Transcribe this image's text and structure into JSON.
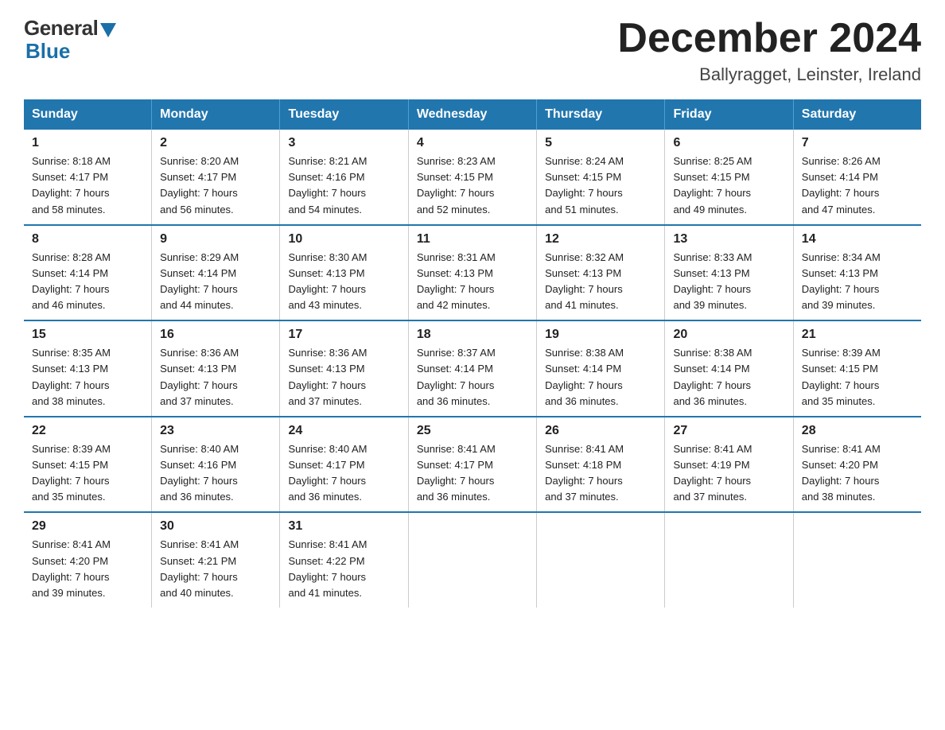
{
  "logo": {
    "general": "General",
    "blue": "Blue",
    "arrow": "▼"
  },
  "title": "December 2024",
  "subtitle": "Ballyragget, Leinster, Ireland",
  "weekdays": [
    "Sunday",
    "Monday",
    "Tuesday",
    "Wednesday",
    "Thursday",
    "Friday",
    "Saturday"
  ],
  "weeks": [
    [
      {
        "day": "1",
        "info": "Sunrise: 8:18 AM\nSunset: 4:17 PM\nDaylight: 7 hours\nand 58 minutes."
      },
      {
        "day": "2",
        "info": "Sunrise: 8:20 AM\nSunset: 4:17 PM\nDaylight: 7 hours\nand 56 minutes."
      },
      {
        "day": "3",
        "info": "Sunrise: 8:21 AM\nSunset: 4:16 PM\nDaylight: 7 hours\nand 54 minutes."
      },
      {
        "day": "4",
        "info": "Sunrise: 8:23 AM\nSunset: 4:15 PM\nDaylight: 7 hours\nand 52 minutes."
      },
      {
        "day": "5",
        "info": "Sunrise: 8:24 AM\nSunset: 4:15 PM\nDaylight: 7 hours\nand 51 minutes."
      },
      {
        "day": "6",
        "info": "Sunrise: 8:25 AM\nSunset: 4:15 PM\nDaylight: 7 hours\nand 49 minutes."
      },
      {
        "day": "7",
        "info": "Sunrise: 8:26 AM\nSunset: 4:14 PM\nDaylight: 7 hours\nand 47 minutes."
      }
    ],
    [
      {
        "day": "8",
        "info": "Sunrise: 8:28 AM\nSunset: 4:14 PM\nDaylight: 7 hours\nand 46 minutes."
      },
      {
        "day": "9",
        "info": "Sunrise: 8:29 AM\nSunset: 4:14 PM\nDaylight: 7 hours\nand 44 minutes."
      },
      {
        "day": "10",
        "info": "Sunrise: 8:30 AM\nSunset: 4:13 PM\nDaylight: 7 hours\nand 43 minutes."
      },
      {
        "day": "11",
        "info": "Sunrise: 8:31 AM\nSunset: 4:13 PM\nDaylight: 7 hours\nand 42 minutes."
      },
      {
        "day": "12",
        "info": "Sunrise: 8:32 AM\nSunset: 4:13 PM\nDaylight: 7 hours\nand 41 minutes."
      },
      {
        "day": "13",
        "info": "Sunrise: 8:33 AM\nSunset: 4:13 PM\nDaylight: 7 hours\nand 39 minutes."
      },
      {
        "day": "14",
        "info": "Sunrise: 8:34 AM\nSunset: 4:13 PM\nDaylight: 7 hours\nand 39 minutes."
      }
    ],
    [
      {
        "day": "15",
        "info": "Sunrise: 8:35 AM\nSunset: 4:13 PM\nDaylight: 7 hours\nand 38 minutes."
      },
      {
        "day": "16",
        "info": "Sunrise: 8:36 AM\nSunset: 4:13 PM\nDaylight: 7 hours\nand 37 minutes."
      },
      {
        "day": "17",
        "info": "Sunrise: 8:36 AM\nSunset: 4:13 PM\nDaylight: 7 hours\nand 37 minutes."
      },
      {
        "day": "18",
        "info": "Sunrise: 8:37 AM\nSunset: 4:14 PM\nDaylight: 7 hours\nand 36 minutes."
      },
      {
        "day": "19",
        "info": "Sunrise: 8:38 AM\nSunset: 4:14 PM\nDaylight: 7 hours\nand 36 minutes."
      },
      {
        "day": "20",
        "info": "Sunrise: 8:38 AM\nSunset: 4:14 PM\nDaylight: 7 hours\nand 36 minutes."
      },
      {
        "day": "21",
        "info": "Sunrise: 8:39 AM\nSunset: 4:15 PM\nDaylight: 7 hours\nand 35 minutes."
      }
    ],
    [
      {
        "day": "22",
        "info": "Sunrise: 8:39 AM\nSunset: 4:15 PM\nDaylight: 7 hours\nand 35 minutes."
      },
      {
        "day": "23",
        "info": "Sunrise: 8:40 AM\nSunset: 4:16 PM\nDaylight: 7 hours\nand 36 minutes."
      },
      {
        "day": "24",
        "info": "Sunrise: 8:40 AM\nSunset: 4:17 PM\nDaylight: 7 hours\nand 36 minutes."
      },
      {
        "day": "25",
        "info": "Sunrise: 8:41 AM\nSunset: 4:17 PM\nDaylight: 7 hours\nand 36 minutes."
      },
      {
        "day": "26",
        "info": "Sunrise: 8:41 AM\nSunset: 4:18 PM\nDaylight: 7 hours\nand 37 minutes."
      },
      {
        "day": "27",
        "info": "Sunrise: 8:41 AM\nSunset: 4:19 PM\nDaylight: 7 hours\nand 37 minutes."
      },
      {
        "day": "28",
        "info": "Sunrise: 8:41 AM\nSunset: 4:20 PM\nDaylight: 7 hours\nand 38 minutes."
      }
    ],
    [
      {
        "day": "29",
        "info": "Sunrise: 8:41 AM\nSunset: 4:20 PM\nDaylight: 7 hours\nand 39 minutes."
      },
      {
        "day": "30",
        "info": "Sunrise: 8:41 AM\nSunset: 4:21 PM\nDaylight: 7 hours\nand 40 minutes."
      },
      {
        "day": "31",
        "info": "Sunrise: 8:41 AM\nSunset: 4:22 PM\nDaylight: 7 hours\nand 41 minutes."
      },
      {
        "day": "",
        "info": ""
      },
      {
        "day": "",
        "info": ""
      },
      {
        "day": "",
        "info": ""
      },
      {
        "day": "",
        "info": ""
      }
    ]
  ]
}
